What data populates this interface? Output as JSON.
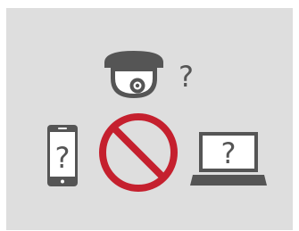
{
  "illustration": {
    "camera": {
      "icon": "security-dome-camera-icon",
      "question_mark": "?"
    },
    "phone": {
      "icon": "smartphone-icon",
      "question_mark": "?"
    },
    "prohibited": {
      "icon": "no-entry-prohibited-icon"
    },
    "laptop": {
      "icon": "laptop-icon",
      "question_mark": "?"
    },
    "colors": {
      "background": "#dedede",
      "device": "#555555",
      "prohibited": "#c5202e"
    }
  }
}
